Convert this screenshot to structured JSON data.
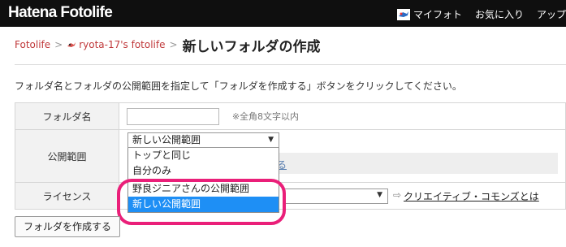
{
  "header": {
    "logo": "Hatena Fotolife",
    "nav": {
      "my_photo": "マイフォト",
      "favorites": "お気に入り",
      "upload": "アップ"
    }
  },
  "breadcrumb": {
    "root": "Fotolife",
    "user": "ryota-17's fotolife",
    "separator": ">",
    "title": "新しいフォルダの作成"
  },
  "intro": "フォルダ名とフォルダの公開範囲を指定して「フォルダを作成する」ボタンをクリックしてください。",
  "form": {
    "folder_name": {
      "label": "フォルダ名",
      "value": "",
      "hint": "※全角8文字以内"
    },
    "scope": {
      "label": "公開範囲",
      "selected": "新しい公開範囲",
      "options": [
        "トップと同じ",
        "自分のみ",
        "野良ジニアさんの公開範囲",
        "新しい公開範囲"
      ],
      "highlighted_index": 3,
      "partial_link": "る"
    },
    "license": {
      "label": "ライセンス",
      "link": "クリエイティブ・コモンズとは"
    }
  },
  "submit_label": "フォルダを作成する",
  "colors": {
    "header_bg": "#0f0f0f",
    "link": "#c0393b",
    "highlight": "#1e8ff5",
    "annotation": "#ea1f79"
  }
}
